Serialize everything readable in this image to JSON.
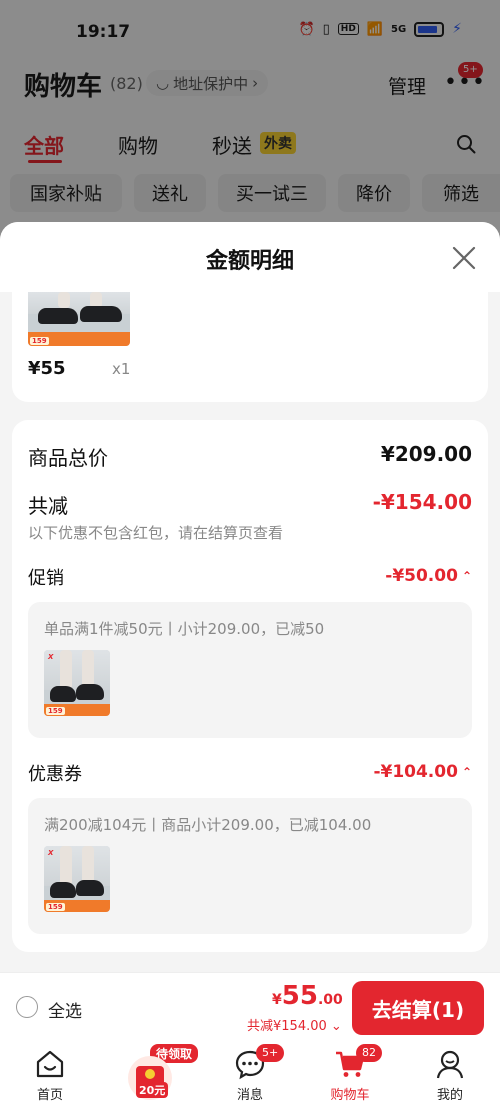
{
  "status_bar": {
    "time": "19:17",
    "network": "5G",
    "hd": "HD"
  },
  "header": {
    "title": "购物车",
    "count": "(82)",
    "address": "地址保护中",
    "manage": "管理",
    "more_badge": "5+"
  },
  "tabs": [
    {
      "label": "全部",
      "active": true
    },
    {
      "label": "购物",
      "active": false
    },
    {
      "label": "秒送",
      "active": false
    }
  ],
  "tab_tag": "外卖",
  "chips": [
    "国家补贴",
    "送礼",
    "买一试三",
    "降价",
    "筛选"
  ],
  "sheet": {
    "title": "金额明细",
    "top_item": {
      "price": "¥55",
      "qty": "x1",
      "thumb_price": "159"
    },
    "total_label": "商品总价",
    "total_value": "¥209.00",
    "discount_label": "共减",
    "discount_value": "-¥154.00",
    "discount_note": "以下优惠不包含红包，请在结算页查看",
    "promo": {
      "label": "促销",
      "value": "-¥50.00",
      "detail": "单品满1件减50元丨小计209.00，已减50",
      "thumb_price": "159"
    },
    "coupon": {
      "label": "优惠券",
      "value": "-¥104.00",
      "detail": "满200减104元丨商品小计209.00，已减104.00",
      "thumb_price": "159"
    }
  },
  "bottom_bar": {
    "select_all": "全选",
    "currency": "¥",
    "total_int": "55",
    "total_dec": ".00",
    "saved": "共减¥154.00",
    "checkout": "去结算(1)"
  },
  "nav": {
    "items": [
      {
        "label": "首页",
        "active": false
      },
      {
        "label": "",
        "active": false
      },
      {
        "label": "消息",
        "active": false,
        "badge": "5+"
      },
      {
        "label": "购物车",
        "active": true,
        "badge": "82"
      },
      {
        "label": "我的",
        "active": false
      }
    ],
    "coupon_tag": "待领取",
    "coupon_amount": "20元"
  },
  "colors": {
    "accent": "#e3262f",
    "tag_yellow": "#f5cf32"
  }
}
